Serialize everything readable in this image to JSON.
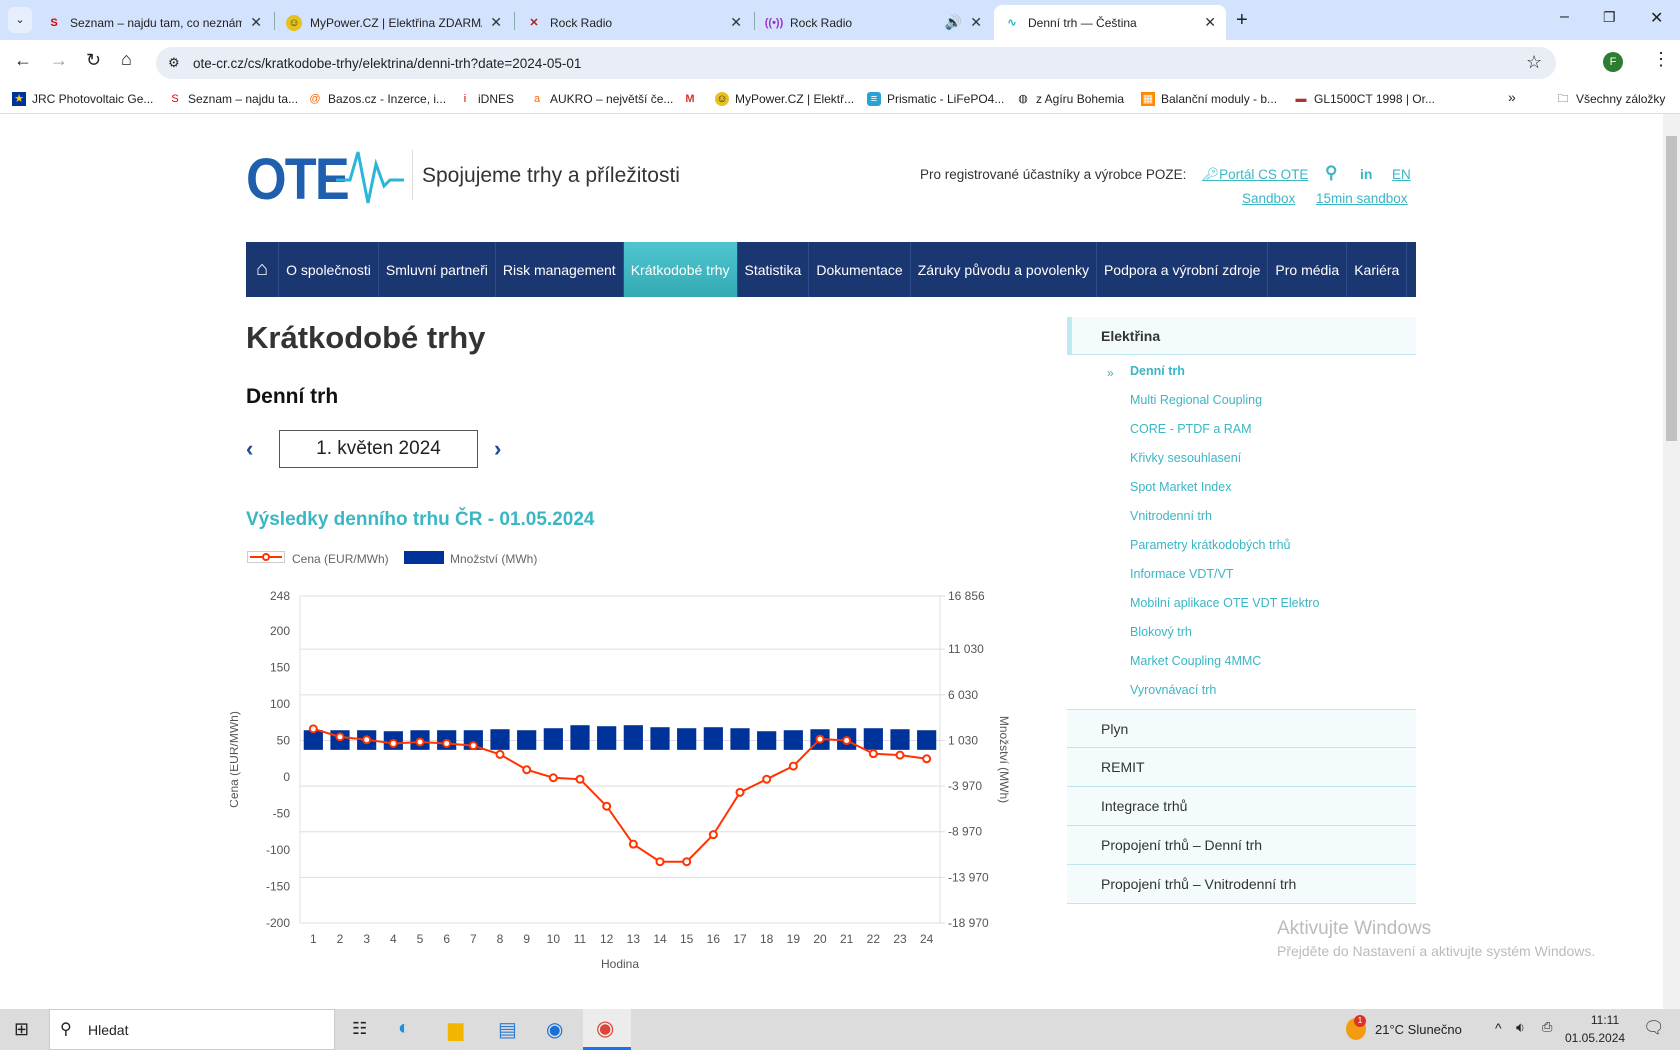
{
  "browser": {
    "tabs": [
      {
        "title": "Seznam – najdu tam, co neznám",
        "icon": "seznam-icon"
      },
      {
        "title": "MyPower.CZ | Elektřina ZDARMA",
        "icon": "mypower-icon"
      },
      {
        "title": "Rock Radio",
        "icon": "rockradio-icon"
      },
      {
        "title": "Rock Radio",
        "icon": "radio-icon"
      },
      {
        "title": "Denní trh — Čeština",
        "icon": "ote-icon"
      }
    ],
    "url": "ote-cr.cz/cs/kratkodobe-trhy/elektrina/denni-trh?date=2024-05-01",
    "profile_initial": "F",
    "bookmarks": [
      "JRC Photovoltaic Ge...",
      "Seznam – najdu ta...",
      "Bazos.cz - Inzerce, i...",
      "iDNES",
      "AUKRO – největší če...",
      "",
      "MyPower.CZ | Elektř...",
      "Prismatic - LiFePO4...",
      "z Agíru Bohemia",
      "Balanční moduly - b...",
      "GL1500CT 1998 | Or..."
    ],
    "all_bookmarks": "Všechny záložky",
    "more": "»"
  },
  "header": {
    "logo": "OTE",
    "tagline": "Spojujeme trhy a příležitosti",
    "reg_text": "Pro registrované účastníky a výrobce POZE:",
    "portal": "Portál CS OTE",
    "linkedin": "in",
    "lang": "EN",
    "sandbox": "Sandbox",
    "sandbox15": "15min sandbox"
  },
  "nav": [
    "O společnosti",
    "Smluvní partneři",
    "Risk management",
    "Krátkodobé trhy",
    "Statistika",
    "Dokumentace",
    "Záruky původu a povolenky",
    "Podpora a výrobní zdroje",
    "Pro média",
    "Kariéra"
  ],
  "main": {
    "title": "Krátkodobé trhy",
    "subtitle": "Denní trh",
    "date": "1. květen 2024",
    "chart_title": "Výsledky denního trhu ČR - 01.05.2024"
  },
  "chart_data": {
    "type": "bar+line",
    "title": "Výsledky denního trhu ČR - 01.05.2024",
    "xlabel": "Hodina",
    "ylabel": "Cena (EUR/MWh)",
    "y2label": "Množství (MWh)",
    "categories": [
      "1",
      "2",
      "3",
      "4",
      "5",
      "6",
      "7",
      "8",
      "9",
      "10",
      "11",
      "12",
      "13",
      "14",
      "15",
      "16",
      "17",
      "18",
      "19",
      "20",
      "21",
      "22",
      "23",
      "24"
    ],
    "ylim": [
      -200,
      248
    ],
    "y2lim": [
      -18970,
      16856
    ],
    "yticks": [
      "248",
      "200",
      "150",
      "100",
      "50",
      "0",
      "-50",
      "-100",
      "-150",
      "-200"
    ],
    "yticks_values": [
      248,
      200,
      150,
      100,
      50,
      0,
      -50,
      -100,
      -150,
      -200
    ],
    "y2ticks": [
      "16 856",
      "11 030",
      "6 030",
      "1 030",
      "-3 970",
      "-8 970",
      "-13 970",
      "-18 970"
    ],
    "y2ticks_values": [
      16856,
      11030,
      6030,
      1030,
      -3970,
      -8970,
      -13970,
      -18970
    ],
    "series": [
      {
        "name": "Cena (EUR/MWh)",
        "type": "line",
        "color": "#ff3300",
        "values": [
          66,
          55,
          51,
          46,
          48,
          46,
          43,
          31,
          10,
          -1,
          -3,
          -40,
          -92,
          -116,
          -116,
          -79,
          -21,
          -3,
          15,
          52,
          50,
          32,
          30,
          25
        ]
      },
      {
        "name": "Množství (MWh)",
        "type": "bar",
        "color": "#003399",
        "values": [
          2150,
          2150,
          2150,
          2040,
          2150,
          2150,
          2150,
          2260,
          2150,
          2370,
          2700,
          2590,
          2700,
          2480,
          2370,
          2480,
          2370,
          2040,
          2150,
          2260,
          2370,
          2370,
          2260,
          2150
        ]
      }
    ],
    "legend": "top-left"
  },
  "sidebar": {
    "sections": [
      "Elektřina",
      "Plyn",
      "REMIT",
      "Integrace trhů",
      "Propojení trhů – Denní trh",
      "Propojení trhů – Vnitrodenní trh"
    ],
    "marker": "»",
    "items": [
      "Denní trh",
      "Multi Regional Coupling",
      "CORE - PTDF a RAM",
      "Křivky sesouhlasení",
      "Spot Market Index",
      "Vnitrodenní trh",
      "Parametry krátkodobých trhů",
      "Informace VDT/VT",
      "Mobilní aplikace OTE VDT Elektro",
      "Blokový trh",
      "Market Coupling 4MMC",
      "Vyrovnávací trh"
    ]
  },
  "watermark": {
    "title": "Aktivujte Windows",
    "text": "Přejděte do Nastavení a aktivujte systém Windows."
  },
  "taskbar": {
    "search": "Hledat",
    "weather": "21°C  Slunečno",
    "badge": "1",
    "time": "11:11",
    "date": "01.05.2024"
  }
}
